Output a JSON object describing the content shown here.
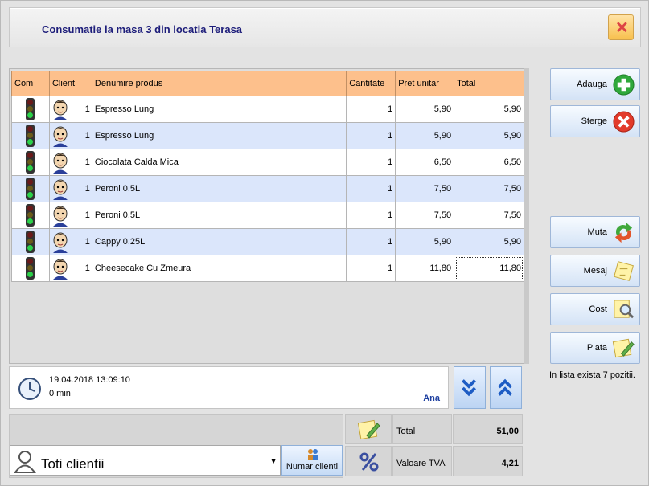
{
  "window": {
    "title": "Consumatie la masa 3 din locatia Terasa",
    "close_label": "✕"
  },
  "table": {
    "headers": {
      "com": "Com",
      "client": "Client",
      "product": "Denumire produs",
      "qty": "Cantitate",
      "unit": "Pret unitar",
      "total": "Total"
    },
    "rows": [
      {
        "client": "1",
        "product": "Espresso Lung",
        "qty": "1",
        "unit": "5,90",
        "total": "5,90"
      },
      {
        "client": "1",
        "product": "Espresso Lung",
        "qty": "1",
        "unit": "5,90",
        "total": "5,90"
      },
      {
        "client": "1",
        "product": "Ciocolata Calda Mica",
        "qty": "1",
        "unit": "6,50",
        "total": "6,50"
      },
      {
        "client": "1",
        "product": "Peroni 0.5L",
        "qty": "1",
        "unit": "7,50",
        "total": "7,50"
      },
      {
        "client": "1",
        "product": "Peroni 0.5L",
        "qty": "1",
        "unit": "7,50",
        "total": "7,50"
      },
      {
        "client": "1",
        "product": "Cappy 0.25L",
        "qty": "1",
        "unit": "5,90",
        "total": "5,90"
      },
      {
        "client": "1",
        "product": "Cheesecake Cu Zmeura",
        "qty": "1",
        "unit": "11,80",
        "total": "11,80"
      }
    ]
  },
  "side": {
    "adauga": "Adauga",
    "sterge": "Sterge",
    "muta": "Muta",
    "mesaj": "Mesaj",
    "cost": "Cost",
    "plata": "Plata",
    "count_text": "In lista exista 7 pozitii."
  },
  "info": {
    "datetime": "19.04.2018 13:09:10",
    "duration": "0 min",
    "user": "Ana"
  },
  "bottom": {
    "client_select": "Toti clientii",
    "numar_clienti": "Numar clienti",
    "total_label": "Total",
    "total_value": "51,00",
    "tva_label": "Valoare TVA",
    "tva_value": "4,21"
  },
  "colors": {
    "header": "#fdc08c",
    "row_alt": "#dbe6fb",
    "title": "#1d1d7a"
  }
}
